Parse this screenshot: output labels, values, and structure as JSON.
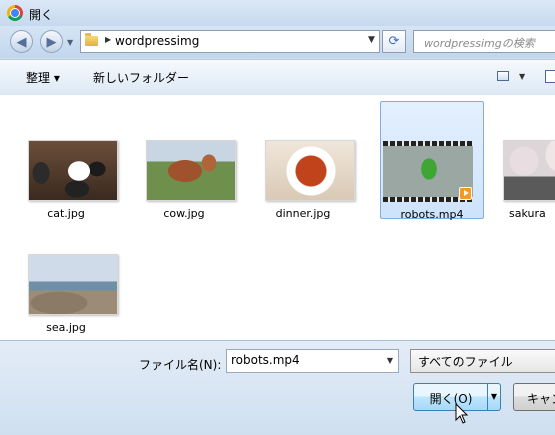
{
  "window": {
    "title": "開く"
  },
  "address": {
    "folder": "wordpressimg"
  },
  "search": {
    "placeholder": "wordpressimgの検索"
  },
  "toolbar": {
    "organize_label": "整理 ▾",
    "new_folder_label": "新しいフォルダー"
  },
  "files": [
    {
      "name": "cat.jpg",
      "kind": "image",
      "selected": false
    },
    {
      "name": "cow.jpg",
      "kind": "image",
      "selected": false
    },
    {
      "name": "dinner.jpg",
      "kind": "image",
      "selected": false
    },
    {
      "name": "robots.mp4",
      "kind": "video",
      "selected": true
    },
    {
      "name": "sakura",
      "kind": "image",
      "selected": false
    },
    {
      "name": "sea.jpg",
      "kind": "image",
      "selected": false
    }
  ],
  "footer": {
    "filename_label": "ファイル名(N):",
    "filename_value": "robots.mp4",
    "filetype_value": "すべてのファイル",
    "open_label": "開く(O)",
    "cancel_label": "キャン"
  },
  "colors": {
    "selection": "#cde3fb",
    "open_button_border": "#3c7fb1"
  }
}
